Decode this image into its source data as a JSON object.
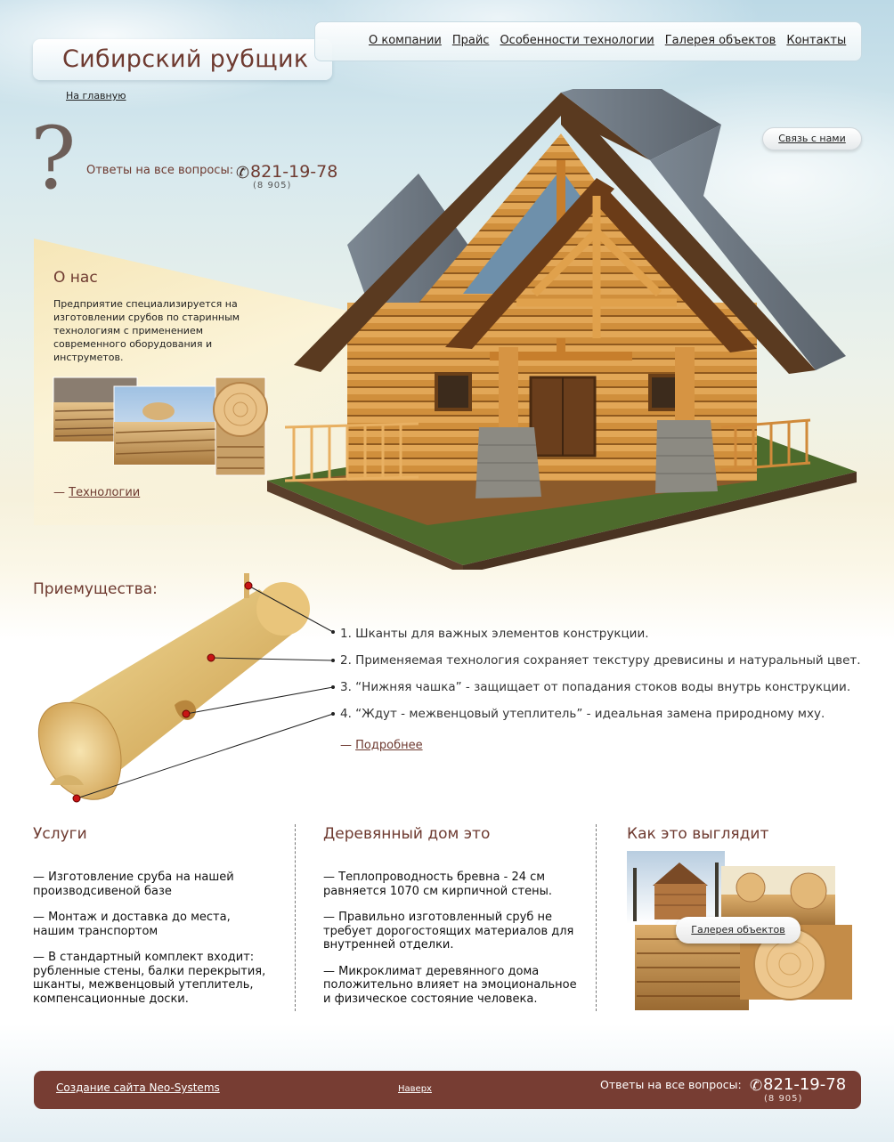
{
  "header": {
    "logo": "Сибирский рубщик",
    "home_link": "На главную",
    "nav": [
      "О компании",
      "Прайс",
      "Особенности технологии",
      "Галерея объектов",
      "Контакты"
    ],
    "contact_button": "Связь с нами"
  },
  "questions": {
    "mark": "?",
    "label": "Ответы на все вопросы:",
    "phone_icon": "phone-icon",
    "phone": "821-19-78",
    "phone_code": "(8 905)"
  },
  "about": {
    "title": "О нас",
    "text": "Предприятие специализируется на изготовлении срубов по старинным технологиям с применением современного оборудования и инструметов.",
    "link_dash": "—",
    "link": "Технологии"
  },
  "advantages": {
    "title": "Приемущества:",
    "items": [
      "1. Шканты для важных элементов конструкции.",
      "2. Применяемая технология сохраняет текстуру древисины и натуральный цвет.",
      "3. “Нижняя чашка” - защищает от попадания стоков воды внутрь конструкции.",
      "4. “Ждут - межвенцовый утеплитель” - идеальная замена природному мху."
    ],
    "more_dash": "—",
    "more": "Подробнее"
  },
  "services": {
    "title": "Услуги",
    "items": [
      "— Изготовление сруба на нашей производсивеной базе",
      "— Монтаж и доставка до места, нашим транспортом",
      "— В стандартный комплект входит: рубленные стены, балки перекрытия, шканты, межвенцовый утеплитель, компенсационные доски."
    ]
  },
  "wooden_house": {
    "title": "Деревянный дом это",
    "items": [
      "— Теплопроводность бревна - 24 см равняется 1070 см кирпичной стены.",
      "— Правильно изготовленный сруб не требует дорогостоящих материалов для внутренней отделки.",
      "— Микроклимат деревянного дома положительно влияет на эмоциональное и физическое состояние человека."
    ]
  },
  "looks": {
    "title": "Как это выглядит",
    "button": "Галерея объектов"
  },
  "footer": {
    "credit": "Создание сайта Neo-Systems",
    "top": "Наверх",
    "answers": "Ответы на все вопросы:",
    "phone": "821-19-78",
    "phone_code": "(8 905)"
  },
  "colors": {
    "brand": "#6e3a30",
    "footer": "#773d33",
    "sky": "#bcd9e6",
    "wood": "#d49a45"
  }
}
